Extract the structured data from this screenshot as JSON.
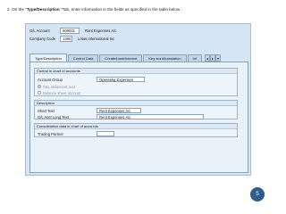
{
  "instruction": {
    "prefix": "2.  On the \"",
    "bold": "Type/Description ",
    "suffix": "\"Tab, enter information in the fields as specified in the table below :"
  },
  "header": {
    "gl_account_label": "G/L Account",
    "gl_account_value": "609001",
    "gl_account_text": "Rent Expenses A/c",
    "company_code_label": "Company Code",
    "company_code_value": "1380",
    "company_code_text": "Lotus International Inc"
  },
  "tabs": [
    "Type/Description",
    "Control Data",
    "Create/bank/interest",
    "Key word/translation",
    "Inf"
  ],
  "tab_controls": [
    "◂",
    "▸",
    "▾"
  ],
  "control_group": {
    "title": "Control in chart of accounts",
    "account_group_label": "Account Group",
    "account_group_value": "Operating Expenses",
    "radio_pl": "P&L statement acct",
    "radio_bs": "Balance sheet account"
  },
  "description_group": {
    "title": "Description",
    "short_text_label": "Short Text",
    "short_text_value": "Rent Expenses A/c",
    "long_text_label": "G/L Acct Long Text",
    "long_text_value": "Rent Expenses A/c"
  },
  "consolidation_group": {
    "title": "Consolidation data in chart of accounts",
    "trading_partner_label": "Trading Partner"
  },
  "page_number": "5",
  "colors": {
    "sap_bg": "#d5e5f3",
    "panel_bg": "#e9f1f9",
    "badge": "#2f5d8c"
  }
}
